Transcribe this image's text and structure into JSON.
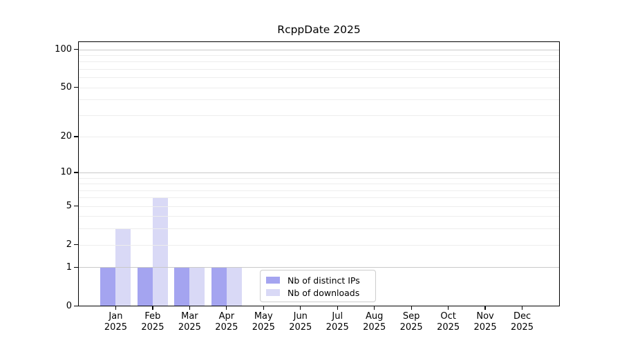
{
  "chart_data": {
    "type": "bar",
    "title": "RcppDate 2025",
    "months": [
      "Jan",
      "Feb",
      "Mar",
      "Apr",
      "May",
      "Jun",
      "Jul",
      "Aug",
      "Sep",
      "Oct",
      "Nov",
      "Dec"
    ],
    "year": "2025",
    "series": [
      {
        "name": "Nb of distinct IPs",
        "color": "#a4a4f0",
        "values": [
          1,
          1,
          1,
          1,
          0,
          0,
          0,
          0,
          0,
          0,
          0,
          0
        ]
      },
      {
        "name": "Nb of downloads",
        "color": "#d9d9f6",
        "values": [
          3,
          6,
          1,
          1,
          0,
          0,
          0,
          0,
          0,
          0,
          0,
          0
        ]
      }
    ],
    "yscale": "log1p",
    "ylim": [
      0,
      115
    ],
    "yticks": [
      0,
      1,
      2,
      5,
      10,
      20,
      50,
      100
    ],
    "gridlines": {
      "major": [
        1,
        10,
        100
      ],
      "minor": [
        2,
        3,
        4,
        5,
        6,
        7,
        8,
        9,
        20,
        30,
        40,
        50,
        60,
        70,
        80,
        90
      ]
    },
    "legend_position": "inside-bottom-center",
    "colors": {
      "major_grid": "#c9c9c9",
      "minor_grid": "#ededed",
      "axis": "#000000",
      "legend_border": "#cccccc"
    }
  }
}
